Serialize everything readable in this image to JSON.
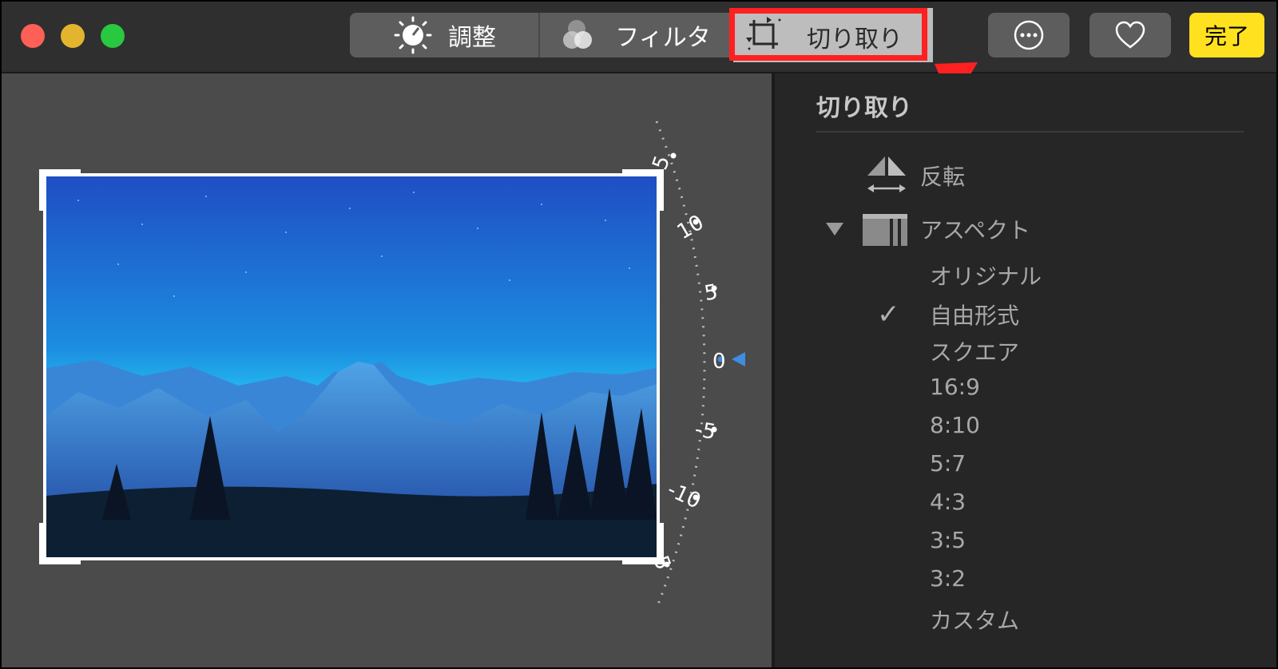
{
  "toolbar": {
    "adjust_label": "調整",
    "filter_label": "フィルタ",
    "crop_label": "切り取り",
    "done_label": "完了",
    "traffic_colors": {
      "close": "#fe5f57",
      "minimize": "#e3b52f",
      "zoom": "#28c840"
    },
    "accent_highlight": "#ff2020"
  },
  "rotation_dial": {
    "labels": [
      "5",
      "10",
      "5",
      "0",
      "-5",
      "-10",
      "5"
    ],
    "current_value": "0",
    "indicator_color": "#3e8de0"
  },
  "panel": {
    "title": "切り取り",
    "flip_label": "反転",
    "aspect_label": "アスペクト",
    "aspect_options": [
      "オリジナル",
      "自由形式",
      "スクエア",
      "16:9",
      "8:10",
      "5:7",
      "4:3",
      "3:5",
      "3:2",
      "カスタム"
    ],
    "selected_option": "自由形式",
    "check_mark": "✓"
  }
}
